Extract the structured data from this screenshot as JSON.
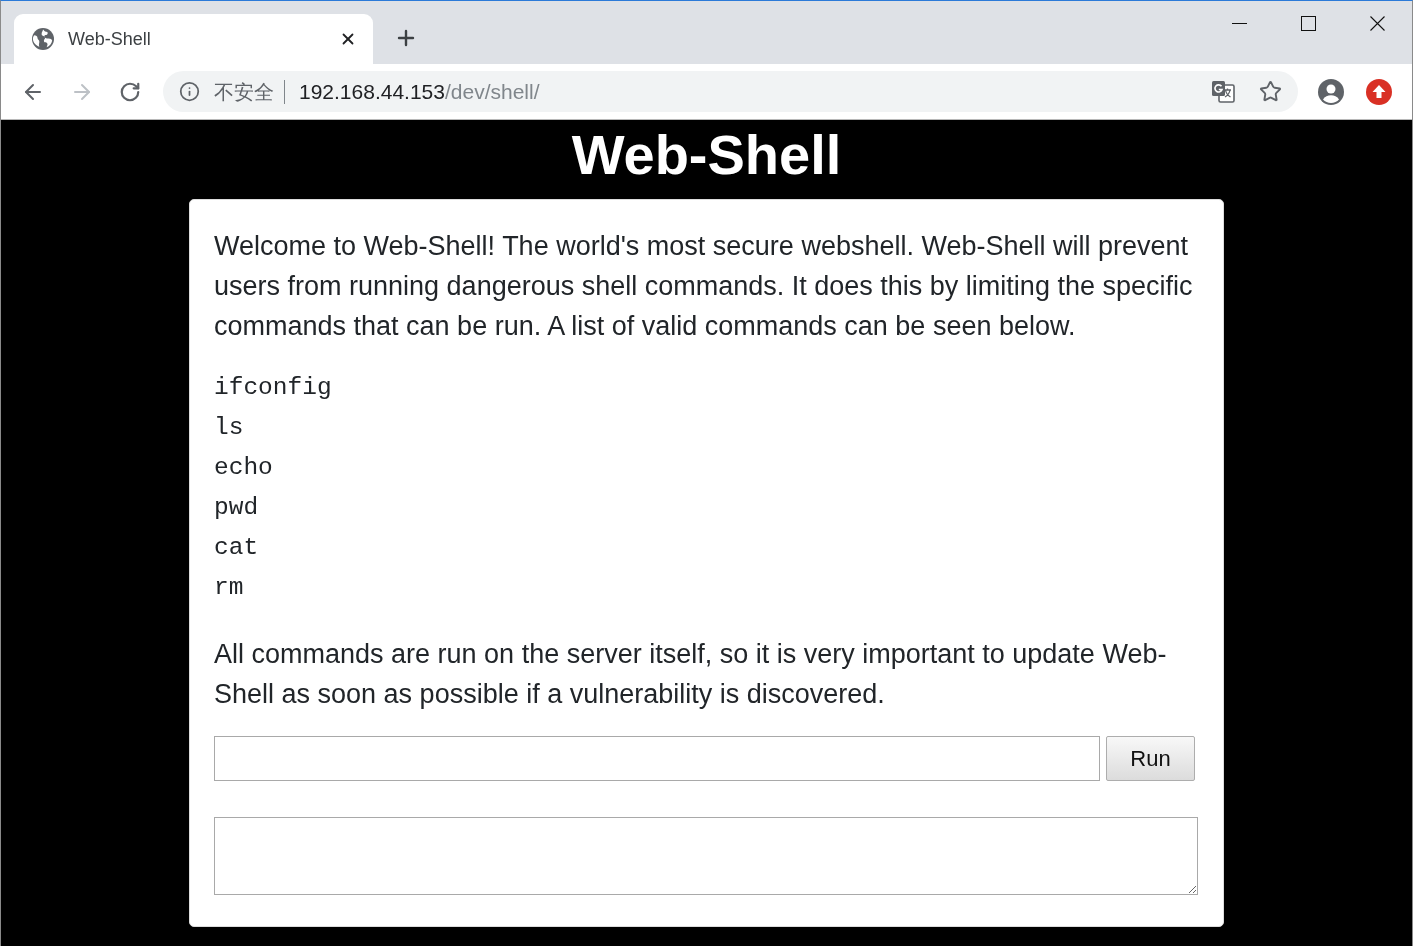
{
  "browser": {
    "tabs": [
      {
        "title": "Web-Shell",
        "selected": true
      }
    ],
    "toolbar": {
      "forward_disabled": true
    },
    "address_bar": {
      "security_label": "不安全",
      "host": "192.168.44.153",
      "path": "/dev/shell/"
    }
  },
  "page": {
    "heading": "Web-Shell",
    "intro": "Welcome to Web-Shell! The world's most secure webshell. Web-Shell will prevent users from running dangerous shell commands. It does this by limiting the specific commands that can be run. A list of valid commands can be seen below.",
    "commands": [
      "ifconfig",
      "ls",
      "echo",
      "pwd",
      "cat",
      "rm"
    ],
    "note": "All commands are run on the server itself, so it is very important to update Web-Shell as soon as possible if a vulnerability is discovered.",
    "run_button": "Run"
  }
}
